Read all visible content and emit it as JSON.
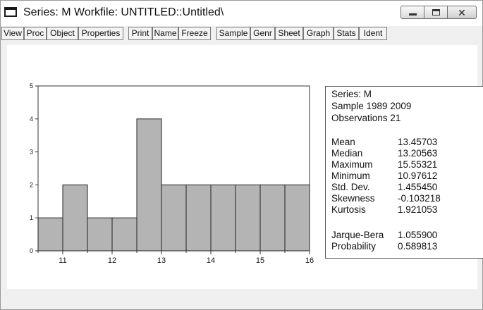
{
  "window": {
    "title": "Series: M   Workfile: UNTITLED::Untitled\\"
  },
  "toolbar": {
    "buttons": [
      "View",
      "Proc",
      "Object",
      "Properties",
      "Print",
      "Name",
      "Freeze",
      "Sample",
      "Genr",
      "Sheet",
      "Graph",
      "Stats",
      "Ident"
    ]
  },
  "stats": {
    "series_line": "Series: M",
    "sample_line": "Sample 1989 2009",
    "observations_line": "Observations 21",
    "rows": [
      {
        "label": "Mean",
        "value": "13.45703"
      },
      {
        "label": "Median",
        "value": "13.20563"
      },
      {
        "label": "Maximum",
        "value": "15.55321"
      },
      {
        "label": "Minimum",
        "value": "10.97612"
      },
      {
        "label": "Std. Dev.",
        "value": "1.455450"
      },
      {
        "label": "Skewness",
        "value": "-0.103218"
      },
      {
        "label": "Kurtosis",
        "value": "1.921053"
      }
    ],
    "jb": {
      "label": "Jarque-Bera",
      "value": "1.055900"
    },
    "prob": {
      "label": "Probability",
      "value": "0.589813"
    }
  },
  "chart_data": {
    "type": "bar",
    "bins": [
      {
        "from": 10.5,
        "to": 11.0,
        "count": 1
      },
      {
        "from": 11.0,
        "to": 11.5,
        "count": 2
      },
      {
        "from": 11.5,
        "to": 12.0,
        "count": 1
      },
      {
        "from": 12.0,
        "to": 12.5,
        "count": 1
      },
      {
        "from": 12.5,
        "to": 13.0,
        "count": 4
      },
      {
        "from": 13.0,
        "to": 13.5,
        "count": 2
      },
      {
        "from": 13.5,
        "to": 14.0,
        "count": 2
      },
      {
        "from": 14.0,
        "to": 14.5,
        "count": 2
      },
      {
        "from": 14.5,
        "to": 15.0,
        "count": 2
      },
      {
        "from": 15.0,
        "to": 15.5,
        "count": 2
      },
      {
        "from": 15.5,
        "to": 16.0,
        "count": 2
      }
    ],
    "xlim": [
      10.5,
      16.0
    ],
    "ylim": [
      0,
      5
    ],
    "x_ticks": [
      "11",
      "12",
      "13",
      "14",
      "15",
      "16"
    ],
    "y_ticks": [
      "0",
      "1",
      "2",
      "3",
      "4",
      "5"
    ],
    "bar_color": "#b4b4b4",
    "grid": false
  }
}
